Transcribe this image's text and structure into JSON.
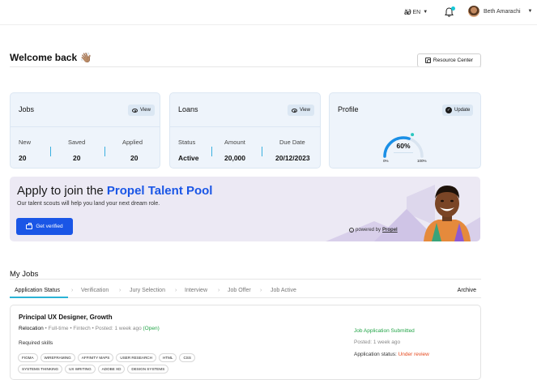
{
  "topbar": {
    "language": "EN",
    "user_name": "Beth Amarachi"
  },
  "welcome": {
    "title": "Welcome back 👋🏽",
    "resource_center": "Resource Center"
  },
  "jobs_card": {
    "title": "Jobs",
    "view_label": "View",
    "stats": [
      {
        "label": "New",
        "value": "20"
      },
      {
        "label": "Saved",
        "value": "20"
      },
      {
        "label": "Applied",
        "value": "20"
      }
    ]
  },
  "loans_card": {
    "title": "Loans",
    "view_label": "View",
    "stats": [
      {
        "label": "Status",
        "value": "Active"
      },
      {
        "label": "Amount",
        "value": "20,000"
      },
      {
        "label": "Due Date",
        "value": "20/12/2023"
      }
    ]
  },
  "profile_card": {
    "title": "Profile",
    "update_label": "Update",
    "completion_percent": 60,
    "completion_label": "60%",
    "gauge_min": "0%",
    "gauge_max": "100%"
  },
  "banner": {
    "title_prefix": "Apply to join the ",
    "title_highlight": "Propel Talent Pool",
    "subtitle": "Our talent scouts will help you land your next dream role.",
    "cta": "Get verified",
    "powered_by": "powered by",
    "powered_brand": "Propel"
  },
  "my_jobs": {
    "title": "My Jobs",
    "tabs": [
      "Application Status",
      "Verification",
      "Jury Selection",
      "Interview",
      "Job Offer",
      "Job Active"
    ],
    "archive": "Archive",
    "job": {
      "title": "Principal UX Designer, Growth",
      "type_first": "Relocation",
      "meta_rest": " • Full-time • Fintech • Posted: 1 week ago ",
      "open": "(Open)",
      "required_skills_label": "Required skills",
      "skills": [
        "FIGMA",
        "WIREFRAMING",
        "AFFINITY MAPS",
        "USER RESEARCH",
        "HTML",
        "CSS",
        "SYSTEMS THINKING",
        "UX WRITING",
        "ADOBE XD",
        "DESIGN SYSTEMS"
      ],
      "submitted": "Job Application Submitted",
      "posted": "Posted: 1 week ago",
      "status_prefix": "Application status: ",
      "status_value": "Under review"
    }
  },
  "colors": {
    "accent_blue": "#1a56e6",
    "tab_underline": "#2ab3d6",
    "success_green": "#22a447",
    "warning_orange": "#e5491e"
  }
}
